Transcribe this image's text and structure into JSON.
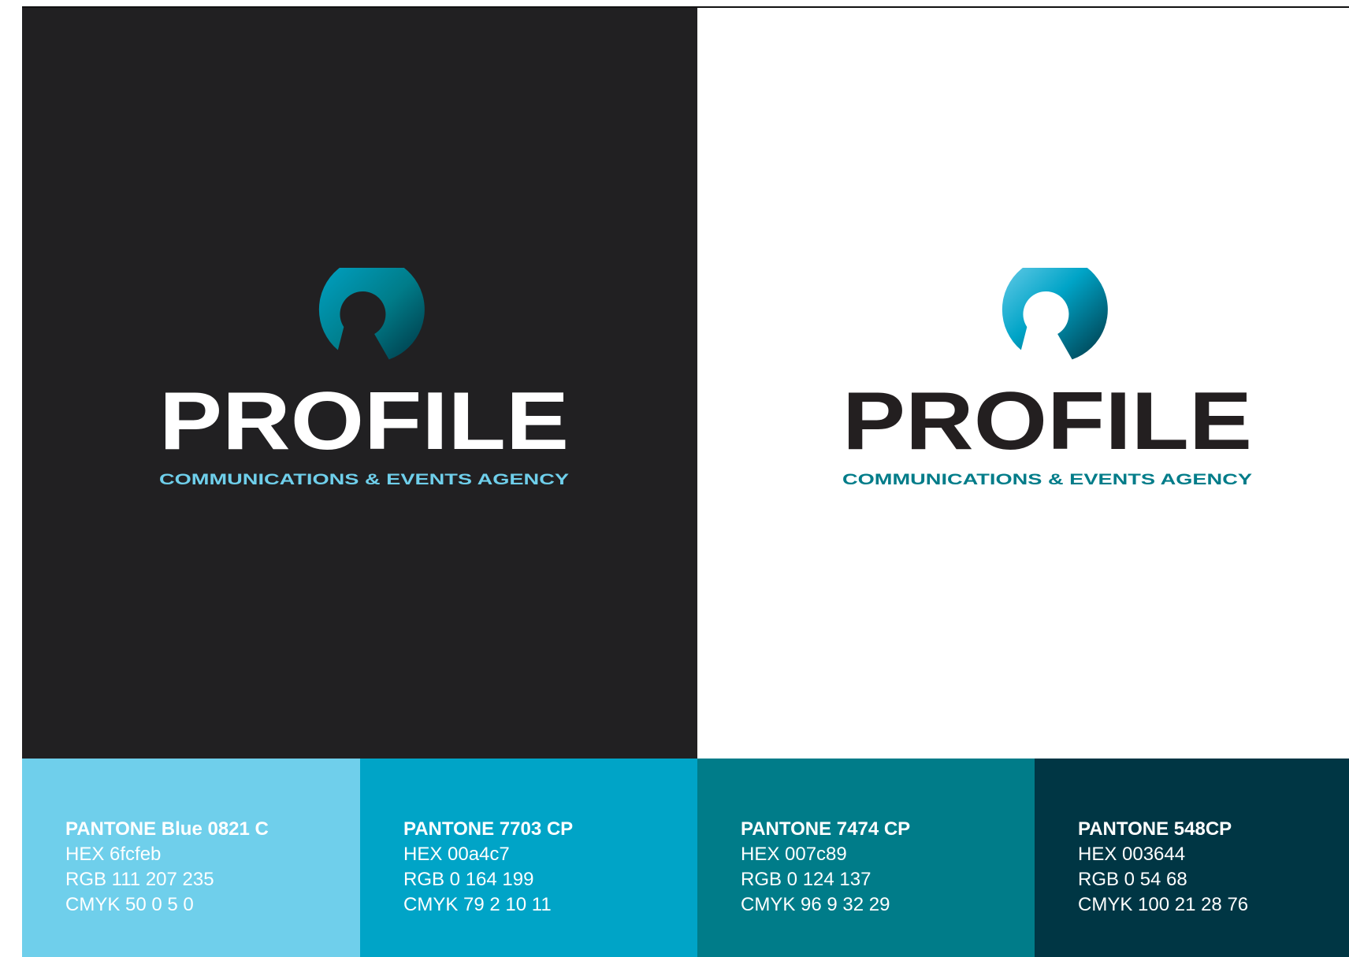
{
  "brand": {
    "wordmark": "PROFILE",
    "tagline": "COMMUNICATIONS & EVENTS AGENCY",
    "icon": "profile-p-circle-icon"
  },
  "panels": {
    "dark": {
      "background": "#212022",
      "wordmark_color": "#ffffff",
      "tagline_color": "#6fcfeb"
    },
    "light": {
      "background": "#ffffff",
      "wordmark_color": "#231f20",
      "tagline_color": "#007c89"
    }
  },
  "swatches": [
    {
      "color": "#6fcfeb",
      "name": "PANTONE Blue 0821 C",
      "hex": "HEX 6fcfeb",
      "rgb": "RGB 111 207 235",
      "cmyk": "CMYK 50 0 5 0"
    },
    {
      "color": "#00a4c7",
      "name": "PANTONE 7703 CP",
      "hex": "HEX 00a4c7",
      "rgb": "RGB 0 164 199",
      "cmyk": "CMYK 79 2 10 11"
    },
    {
      "color": "#007c89",
      "name": "PANTONE 7474 CP",
      "hex": "HEX 007c89",
      "rgb": "RGB 0 124 137",
      "cmyk": "CMYK 96 9 32 29"
    },
    {
      "color": "#003644",
      "name": "PANTONE 548CP",
      "hex": "HEX 003644",
      "rgb": "RGB 0 54 68",
      "cmyk": "CMYK 100 21 28 76"
    }
  ]
}
